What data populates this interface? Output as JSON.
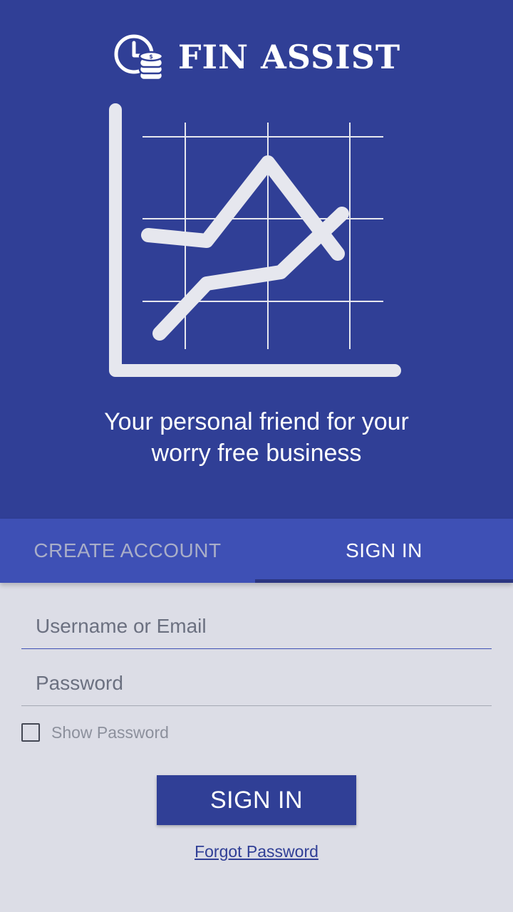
{
  "app": {
    "name": "FIN ASSIST",
    "logo_icon": "clock-coins-icon",
    "hero_icon": "line-chart-icon",
    "tagline_line1": "Your personal friend for your",
    "tagline_line2": "worry free business"
  },
  "tabs": [
    {
      "label": "CREATE ACCOUNT",
      "active": false
    },
    {
      "label": "SIGN IN",
      "active": true
    }
  ],
  "form": {
    "username_placeholder": "Username or Email",
    "username_value": "",
    "password_placeholder": "Password",
    "password_value": "",
    "show_password_label": "Show Password",
    "show_password_checked": false,
    "submit_label": "SIGN IN",
    "forgot_label": "Forgot Password"
  },
  "colors": {
    "primary": "#303f96",
    "tab_bar": "#3e50b5",
    "background": "#dcdde6",
    "illustration": "#e6e7ee"
  }
}
